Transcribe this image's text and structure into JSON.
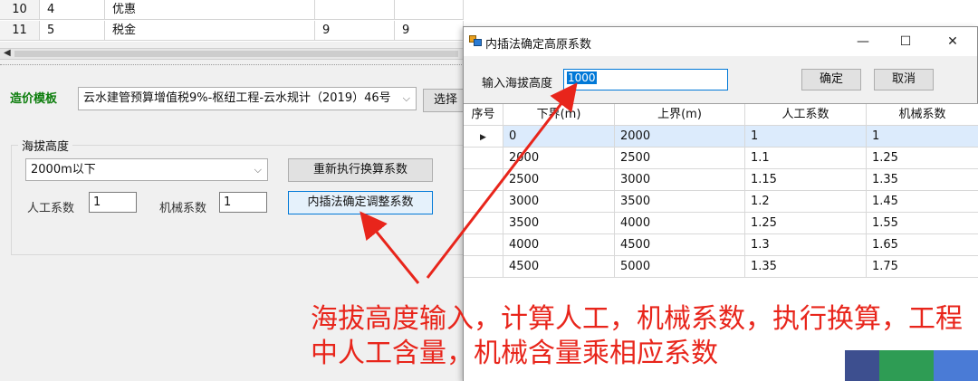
{
  "background_sheet": {
    "rows": [
      {
        "rownum": "10",
        "index": "4",
        "name": "优惠",
        "col_d": "",
        "col_e": ""
      },
      {
        "rownum": "11",
        "index": "5",
        "name": "税金",
        "col_d": "9",
        "col_e": "9"
      }
    ]
  },
  "template": {
    "label": "造价模板",
    "selected": "云水建管预算增值税9%-枢纽工程-云水规计（2019）46号",
    "select_button": "选择"
  },
  "altitude_group": {
    "title": "海拔高度",
    "range_selected": "2000m以下",
    "rerun_button": "重新执行换算系数",
    "interp_button": "内插法确定调整系数",
    "labor_label": "人工系数",
    "labor_value": "1",
    "machine_label": "机械系数",
    "machine_value": "1"
  },
  "dialog": {
    "title": "内插法确定高原系数",
    "altitude_label": "输入海拔高度",
    "altitude_value": "1000",
    "ok_button": "确定",
    "cancel_button": "取消",
    "columns": [
      "序号",
      "下界(m)",
      "上界(m)",
      "人工系数",
      "机械系数"
    ],
    "rows": [
      {
        "lower": "0",
        "upper": "2000",
        "labor": "1",
        "machine": "1"
      },
      {
        "lower": "2000",
        "upper": "2500",
        "labor": "1.1",
        "machine": "1.25"
      },
      {
        "lower": "2500",
        "upper": "3000",
        "labor": "1.15",
        "machine": "1.35"
      },
      {
        "lower": "3000",
        "upper": "3500",
        "labor": "1.2",
        "machine": "1.45"
      },
      {
        "lower": "3500",
        "upper": "4000",
        "labor": "1.25",
        "machine": "1.55"
      },
      {
        "lower": "4000",
        "upper": "4500",
        "labor": "1.3",
        "machine": "1.65"
      },
      {
        "lower": "4500",
        "upper": "5000",
        "labor": "1.35",
        "machine": "1.75"
      }
    ]
  },
  "annotation": {
    "line1": "海拔高度输入，计算人工，机械系数，执行换算，工程",
    "line2": "中人工含量，机械含量乘相应系数"
  },
  "colors": {
    "annotation": "#e8251b",
    "template_label": "#0c7d0c",
    "selection": "#0078d7"
  }
}
